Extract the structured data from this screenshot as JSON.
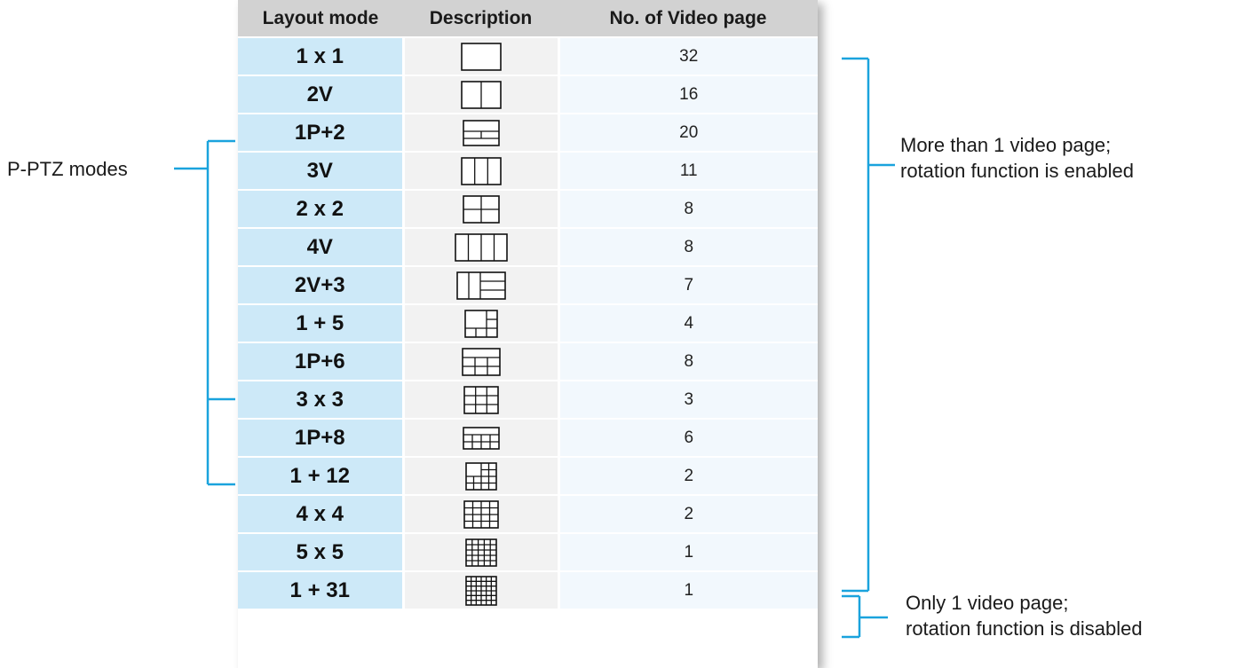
{
  "table": {
    "headers": [
      "Layout mode",
      "Description",
      "No. of Video page"
    ],
    "rows": [
      {
        "mode": "1 x 1",
        "pages": "32",
        "icon": "layout-1x1-icon"
      },
      {
        "mode": "2V",
        "pages": "16",
        "icon": "layout-2v-icon"
      },
      {
        "mode": "1P+2",
        "pages": "20",
        "icon": "layout-1p-2-icon"
      },
      {
        "mode": "3V",
        "pages": "11",
        "icon": "layout-3v-icon"
      },
      {
        "mode": "2 x 2",
        "pages": "8",
        "icon": "layout-2x2-icon"
      },
      {
        "mode": "4V",
        "pages": "8",
        "icon": "layout-4v-icon"
      },
      {
        "mode": "2V+3",
        "pages": "7",
        "icon": "layout-2v-3-icon"
      },
      {
        "mode": "1 + 5",
        "pages": "4",
        "icon": "layout-1-5-icon"
      },
      {
        "mode": "1P+6",
        "pages": "8",
        "icon": "layout-1p-6-icon"
      },
      {
        "mode": "3 x 3",
        "pages": "3",
        "icon": "layout-3x3-icon"
      },
      {
        "mode": "1P+8",
        "pages": "6",
        "icon": "layout-1p-8-icon"
      },
      {
        "mode": "1 + 12",
        "pages": "2",
        "icon": "layout-1-12-icon"
      },
      {
        "mode": "4 x 4",
        "pages": "2",
        "icon": "layout-4x4-icon"
      },
      {
        "mode": "5 x 5",
        "pages": "1",
        "icon": "layout-5x5-icon"
      },
      {
        "mode": "1 + 31",
        "pages": "1",
        "icon": "layout-1-31-icon"
      }
    ]
  },
  "annotations": {
    "pptz_label": "P-PTZ modes",
    "multi_page_line1": "More than 1 video page;",
    "multi_page_line2": "rotation function is enabled",
    "single_page_line1": "Only 1 video page;",
    "single_page_line2": "rotation function is disabled"
  },
  "colors": {
    "header_bg": "#d2d2d2",
    "mode_cell_bg": "#cde9f8",
    "desc_cell_bg": "#f2f2f2",
    "pages_cell_bg": "#f2f8fd",
    "bracket_blue": "#1aa3dd"
  }
}
